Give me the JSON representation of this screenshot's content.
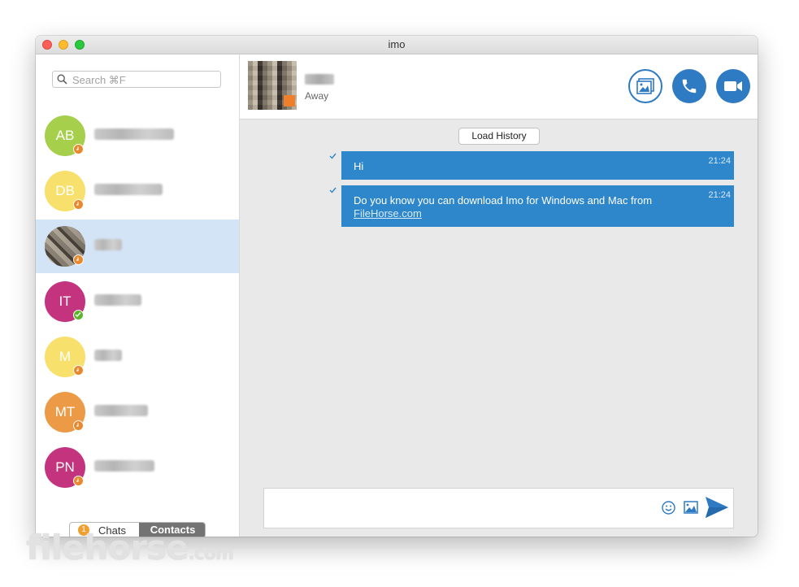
{
  "window": {
    "title": "imo"
  },
  "search": {
    "placeholder": "Search ⌘F"
  },
  "contacts": [
    {
      "initials": "AB",
      "color": "#a6cf4c",
      "status": "away",
      "selected": false
    },
    {
      "initials": "DB",
      "color": "#f7e06b",
      "status": "away",
      "selected": false
    },
    {
      "initials": "",
      "color": "photo",
      "status": "away",
      "selected": true
    },
    {
      "initials": "IT",
      "color": "#c4347e",
      "status": "online",
      "selected": false
    },
    {
      "initials": "M",
      "color": "#f7e06b",
      "status": "away",
      "selected": false
    },
    {
      "initials": "MT",
      "color": "#ec9a46",
      "status": "away",
      "selected": false
    },
    {
      "initials": "PN",
      "color": "#c4347e",
      "status": "away",
      "selected": false
    }
  ],
  "tabs": {
    "chats_count": "1",
    "chats_label": "Chats",
    "contacts_label": "Contacts",
    "active": "Contacts"
  },
  "chat_header": {
    "status": "Away",
    "buttons": [
      "photo-icon",
      "phone-icon",
      "video-icon"
    ],
    "accent": "#2e7ac3"
  },
  "conversation": {
    "load_history": "Load History",
    "messages": [
      {
        "text": "Hi",
        "time": "21:24",
        "delivered": true
      },
      {
        "text": "Do you know you can download Imo for Windows and Mac from",
        "link": "FileHorse.com",
        "time": "21:24",
        "delivered": true
      }
    ],
    "bubble_color": "#2e86cb"
  },
  "composer": {
    "icons": [
      "emoji-icon",
      "image-icon",
      "send-icon"
    ]
  },
  "watermark": {
    "brand": "filehorse",
    "suffix": ".com"
  }
}
